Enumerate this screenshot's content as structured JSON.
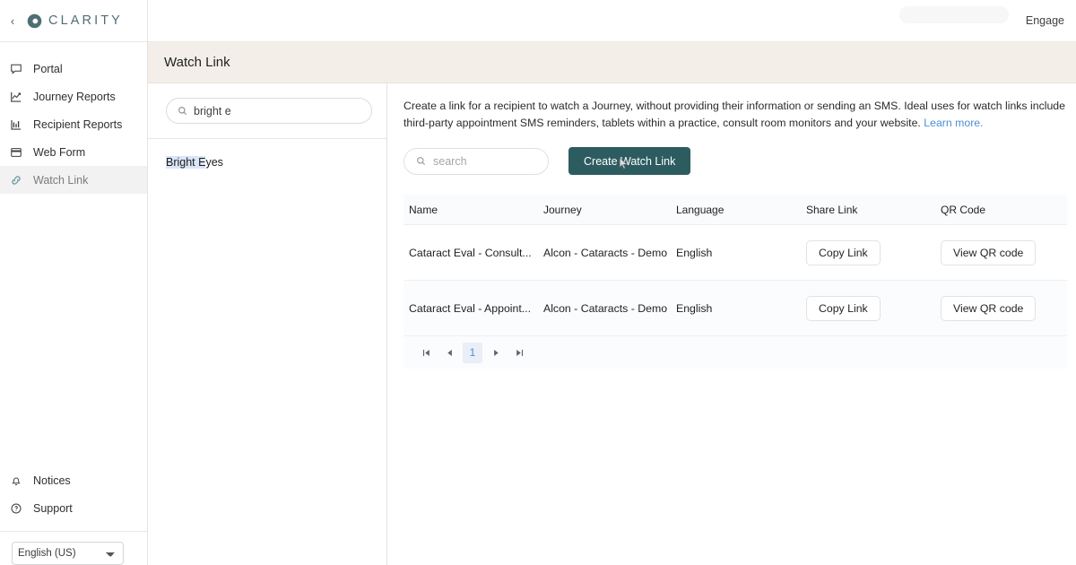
{
  "brand": {
    "name": "CLARITY",
    "logo_icon": "eye-circle-logo-icon",
    "back_icon": "chevron-left-icon",
    "accent": "#4e6f74"
  },
  "topbar": {
    "engage_label": "Engage"
  },
  "page": {
    "title": "Watch Link",
    "header_bg": "#f3efe8"
  },
  "sidebar": {
    "items": [
      {
        "label": "Portal",
        "icon": "speech-bubble-icon",
        "active": false
      },
      {
        "label": "Journey Reports",
        "icon": "line-chart-icon",
        "active": false
      },
      {
        "label": "Recipient Reports",
        "icon": "bar-chart-icon",
        "active": false
      },
      {
        "label": "Web Form",
        "icon": "browser-window-icon",
        "active": false
      },
      {
        "label": "Watch Link",
        "icon": "chain-link-icon",
        "active": true
      }
    ],
    "bottom_items": [
      {
        "label": "Notices",
        "icon": "bell-icon"
      },
      {
        "label": "Support",
        "icon": "question-circle-icon"
      }
    ],
    "language": {
      "selected": "English (US)",
      "options": [
        "English (US)"
      ]
    }
  },
  "list_panel": {
    "search": {
      "value": "bright e",
      "placeholder": "",
      "icon": "search-icon"
    },
    "results": [
      {
        "highlight": "Bright E",
        "rest": "yes"
      }
    ]
  },
  "content": {
    "description": "Create a link for a recipient to watch a Journey, without providing their information or sending an SMS. Ideal uses for watch links include third-party appointment SMS reminders, tablets within a practice, consult room monitors and your website.",
    "learn_more": "Learn more.",
    "learn_more_color": "#4a8fd6",
    "toolbar": {
      "search_placeholder": "search",
      "search_value": "",
      "search_icon": "search-icon",
      "create_button": "Create Watch Link",
      "create_button_color": "#2d5c60",
      "cursor_icon": "mouse-pointer-icon"
    },
    "table": {
      "columns": [
        "Name",
        "Journey",
        "Language",
        "Share Link",
        "QR Code"
      ],
      "rows": [
        {
          "name": "Cataract Eval - Consult...",
          "journey": "Alcon - Cataracts - Demo",
          "language": "English",
          "share_link": "Copy Link",
          "qr_code": "View QR code"
        },
        {
          "name": "Cataract Eval - Appoint...",
          "journey": "Alcon - Cataracts - Demo",
          "language": "English",
          "share_link": "Copy Link",
          "qr_code": "View QR code"
        }
      ]
    },
    "pagination": {
      "first_icon": "page-first-icon",
      "prev_icon": "page-prev-icon",
      "current_page": "1",
      "next_icon": "page-next-icon",
      "last_icon": "page-last-icon"
    }
  }
}
